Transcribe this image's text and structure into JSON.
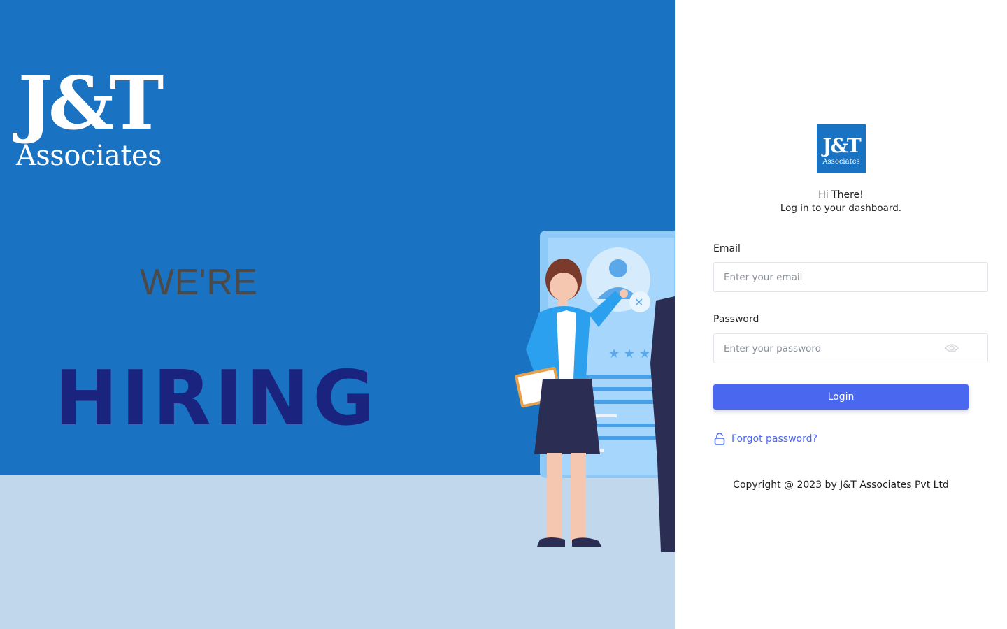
{
  "hero": {
    "brand_mark": "J&T",
    "brand_word": "Associates",
    "headline_1": "WE'RE",
    "headline_2": "HIRING"
  },
  "login": {
    "logo_mark": "J&T",
    "logo_word": "Associates",
    "greeting": "Hi There!",
    "subtitle": "Log in to your dashboard.",
    "email_label": "Email",
    "email_placeholder": "Enter your email",
    "password_label": "Password",
    "password_placeholder": "Enter your password",
    "login_button": "Login",
    "forgot_link": "Forgot password?",
    "copyright": "Copyright @ 2023 by J&T Associates Pvt Ltd"
  },
  "icons": {
    "password_toggle": "eye-icon",
    "forgot": "lock-icon"
  },
  "colors": {
    "brand_blue": "#1a73c2",
    "primary_button": "#4a67f0",
    "hiring_text": "#1a237e"
  }
}
